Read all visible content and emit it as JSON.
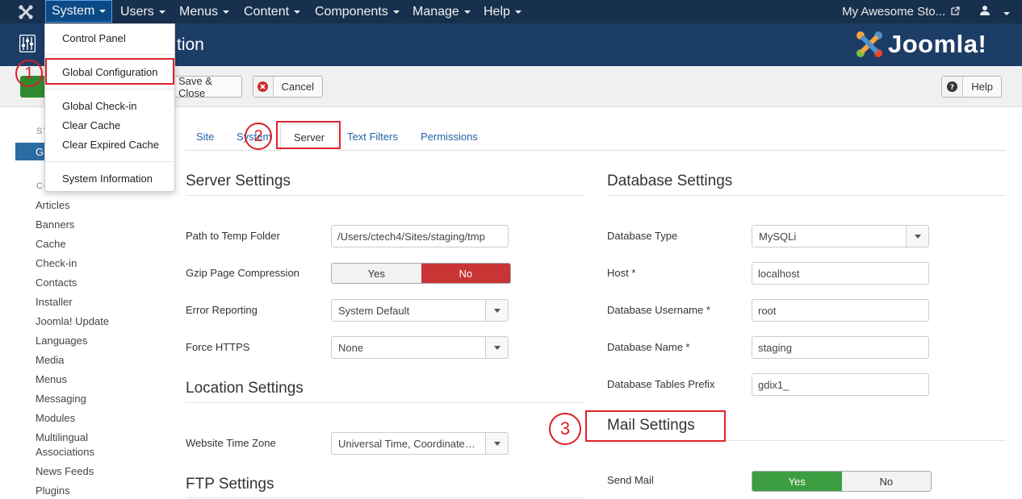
{
  "nav": {
    "menus": [
      "System",
      "Users",
      "Menus",
      "Content",
      "Components",
      "Manage",
      "Help"
    ],
    "site_link": "My Awesome Sto..."
  },
  "header": {
    "title_fragment": "tion",
    "logo_word": "Joomla!"
  },
  "toolbar": {
    "save_close": "Save & Close",
    "cancel": "Cancel",
    "help": "Help"
  },
  "dropdown": {
    "items": [
      "Control Panel",
      "Global Configuration",
      "Global Check-in",
      "Clear Cache",
      "Clear Expired Cache",
      "System Information"
    ]
  },
  "annotations": [
    "1",
    "2",
    "3"
  ],
  "sidebar": {
    "head_system": "SY",
    "active_item": "Gl",
    "head_components": "CO",
    "items": [
      "Articles",
      "Banners",
      "Cache",
      "Check-in",
      "Contacts",
      "Installer",
      "Joomla! Update",
      "Languages",
      "Media",
      "Menus",
      "Messaging",
      "Modules",
      "Multilingual",
      "Associations",
      "News Feeds",
      "Plugins"
    ]
  },
  "tabs": {
    "site": "Site",
    "system": "System",
    "server": "Server",
    "text_filters": "Text Filters",
    "permissions": "Permissions"
  },
  "server_settings": {
    "title": "Server Settings",
    "temp_label": "Path to Temp Folder",
    "temp_value": "/Users/ctech4/Sites/staging/tmp",
    "gzip_label": "Gzip Page Compression",
    "gzip_yes": "Yes",
    "gzip_no": "No",
    "error_label": "Error Reporting",
    "error_value": "System Default",
    "https_label": "Force HTTPS",
    "https_value": "None"
  },
  "location_settings": {
    "title": "Location Settings",
    "tz_label": "Website Time Zone",
    "tz_value": "Universal Time, Coordinated (UTC)"
  },
  "ftp_settings": {
    "title": "FTP Settings"
  },
  "database_settings": {
    "title": "Database Settings",
    "type_label": "Database Type",
    "type_value": "MySQLi",
    "host_label": "Host *",
    "host_value": "localhost",
    "user_label": "Database Username *",
    "user_value": "root",
    "name_label": "Database Name *",
    "name_value": "staging",
    "prefix_label": "Database Tables Prefix",
    "prefix_value": "gdix1_"
  },
  "mail_settings": {
    "title": "Mail Settings",
    "send_label": "Send Mail",
    "send_yes": "Yes",
    "send_no": "No"
  }
}
